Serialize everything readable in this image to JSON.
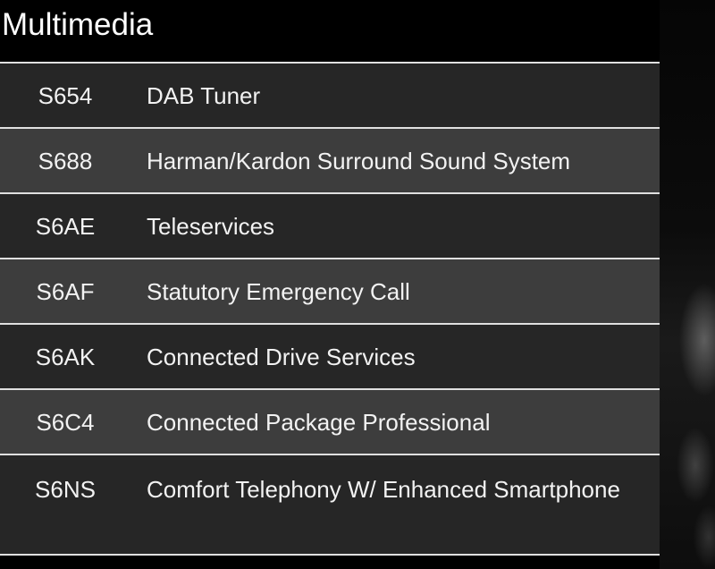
{
  "section": {
    "title": "Multimedia"
  },
  "rows": [
    {
      "code": "S654",
      "description": "DAB Tuner"
    },
    {
      "code": "S688",
      "description": "Harman/Kardon Surround Sound System"
    },
    {
      "code": "S6AE",
      "description": "Teleservices"
    },
    {
      "code": "S6AF",
      "description": "Statutory Emergency Call"
    },
    {
      "code": "S6AK",
      "description": "Connected Drive Services"
    },
    {
      "code": "S6C4",
      "description": "Connected Package Professional"
    },
    {
      "code": "S6NS",
      "description": "Comfort Telephony W/ Enhanced Smartphone"
    }
  ]
}
